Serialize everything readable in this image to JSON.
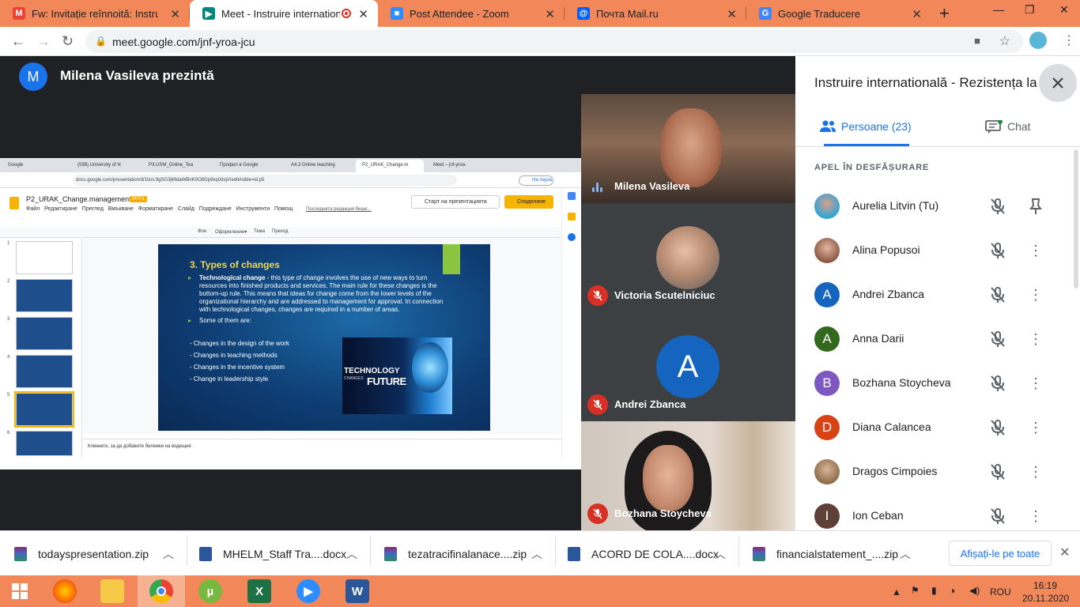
{
  "browser": {
    "tabs": [
      {
        "label": "Fw: Invitație reînnoită: Instruire",
        "icon": "gmail-icon",
        "color": "#ea4335",
        "glyph": "M"
      },
      {
        "label": "Meet - Instruire internationa",
        "icon": "meet-icon",
        "color": "#00897b",
        "glyph": "▶",
        "active": true,
        "recording": true
      },
      {
        "label": "Post Attendee - Zoom",
        "icon": "zoom-icon",
        "color": "#2d8cff",
        "glyph": "■"
      },
      {
        "label": "Почта Mail.ru",
        "icon": "mailru-icon",
        "color": "#005ff9",
        "glyph": "@"
      },
      {
        "label": "Google Traducere",
        "icon": "translate-icon",
        "color": "#4285f4",
        "glyph": "G"
      }
    ],
    "url": "meet.google.com/jnf-yroa-jcu"
  },
  "meet": {
    "presenter_initial": "M",
    "presenter_title": "Milena Vasileva prezintă",
    "tiles": [
      {
        "name": "Milena Vasileva",
        "speaking": true
      },
      {
        "name": "Victoria Scutelniciuc",
        "muted": true
      },
      {
        "name": "Andrei Zbanca",
        "muted": true,
        "initial": "A"
      },
      {
        "name": "Bozhana Stoycheva",
        "muted": true
      }
    ]
  },
  "shared_screen": {
    "tabs": [
      "Google",
      "(598) University of N",
      "P3.USM_Online_Tea",
      "Профил в Google",
      "A4.3 Online teaching",
      "P2_URAK_Change.m",
      "Meet – jnf-yroa-"
    ],
    "url": "docs.google.com/presentation/d/1lxcL9gSG3jMldaWBnK0O8Gp9xq0dsjV/edit#slide=id.p5",
    "pause_label": "На пауза",
    "doc_title": "P2_URAK_Change.management",
    "doc_badge": "PPTX",
    "menu": [
      "Файл",
      "Редактиране",
      "Преглед",
      "Вмъкване",
      "Форматиране",
      "Слайд",
      "Подреждане",
      "Инструменти",
      "Помощ"
    ],
    "last_edit": "Последната редакция беше...",
    "start_label": "Старт на презентацията",
    "share_label": "Споделяне",
    "toolbar": [
      "Фон",
      "Оформление▾",
      "Тема",
      "Преход"
    ],
    "slide_numbers": [
      "1",
      "2",
      "3",
      "4",
      "5",
      "6"
    ],
    "slide": {
      "title": "3. Types of changes",
      "bullet1_bold": "Technological change",
      "bullet1_text": " - this type of change involves the use of new ways to turn resources into finished products and services. The main rule for these changes is the bottom-up rule. This means that ideas for change come from the lower levels of the organizational hierarchy and are addressed to management for approval. In connection with technological changes, changes are required in a number of areas.",
      "bullet2": "Some of them are:",
      "items": [
        "- Changes in the design of the work",
        "- Changes in teaching methods",
        "- Changes in the incentive system",
        "- Change in leadership style"
      ],
      "image_text_1": "TECHNOLOGY",
      "image_text_2": "CHANGES",
      "image_text_3": "FUTURE"
    },
    "notes_placeholder": "Кликнете, за да добавите бележки на водещия"
  },
  "panel": {
    "title": "Instruire internatională - Rezistența la schimbare",
    "people_tab": "Persoane (23)",
    "chat_tab": "Chat",
    "section": "APEL ÎN DESFĂȘURARE",
    "people": [
      {
        "name": "Aurelia Litvin (Tu)",
        "photo": true,
        "color": "#29a3d6",
        "pin": true
      },
      {
        "name": "Alina Popusoi",
        "photo": true,
        "color": "#b07860"
      },
      {
        "name": "Andrei Zbanca",
        "initial": "A",
        "color": "#1a73e8"
      },
      {
        "name": "Anna Darii",
        "initial": "A",
        "color": "#33691e"
      },
      {
        "name": "Bozhana Stoycheva",
        "initial": "B",
        "color": "#7e57c2"
      },
      {
        "name": "Diana Calancea",
        "initial": "D",
        "color": "#d84315"
      },
      {
        "name": "Dragos Cimpoies",
        "photo": true,
        "color": "#8d6e4a"
      },
      {
        "name": "Ion Ceban",
        "initial": "I",
        "color": "#5d4037"
      }
    ]
  },
  "downloads": {
    "items": [
      {
        "name": "todayspresentation.zip",
        "type": "zip"
      },
      {
        "name": "MHELM_Staff Tra....docx",
        "type": "docx"
      },
      {
        "name": "tezatracifinalanace....zip",
        "type": "zip"
      },
      {
        "name": "ACORD DE COLA....docx",
        "type": "docx"
      },
      {
        "name": "financialstatement_....zip",
        "type": "zip"
      }
    ],
    "show_all": "Afișați-le pe toate"
  },
  "taskbar": {
    "apps": [
      "start-button",
      "firefox-app",
      "file-explorer-app",
      "chrome-app",
      "utorrent-app",
      "excel-app",
      "zoom-app",
      "word-app"
    ],
    "language": "ROU",
    "time": "16:19",
    "date": "20.11.2020"
  }
}
